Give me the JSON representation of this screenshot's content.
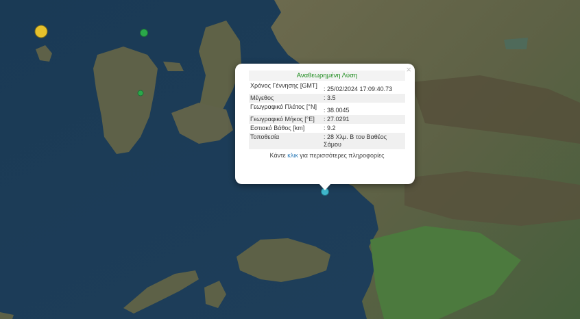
{
  "popup": {
    "title": "Αναθεωρημένη Λύση",
    "close_symbol": "×",
    "rows": [
      {
        "label": "Χρόνος Γέννησης [GMT]",
        "value": ": 25/02/2024 17:09:40.73"
      },
      {
        "label": "Μέγεθος",
        "value": ": 3.5"
      },
      {
        "label": "Γεωγραφικό Πλάτος [°N]",
        "value": ": 38.0045"
      },
      {
        "label": "Γεωγραφικό Μήκος [°E]",
        "value": ": 27.0291"
      },
      {
        "label": "Εστιακό Βάθος [km]",
        "value": ": 9.2"
      },
      {
        "label": "Τοποθεσία",
        "value": ": 28 Χλμ. Β του Βαθέος Σάμου"
      }
    ],
    "footer_prefix": "Κάντε ",
    "footer_link": "κλικ",
    "footer_suffix": " για περισσότερες πληροφορίες"
  },
  "markers": {
    "colors": {
      "selected": "#3fb7cc",
      "recent": "#2aa84a",
      "older": "#e6c12c"
    }
  }
}
